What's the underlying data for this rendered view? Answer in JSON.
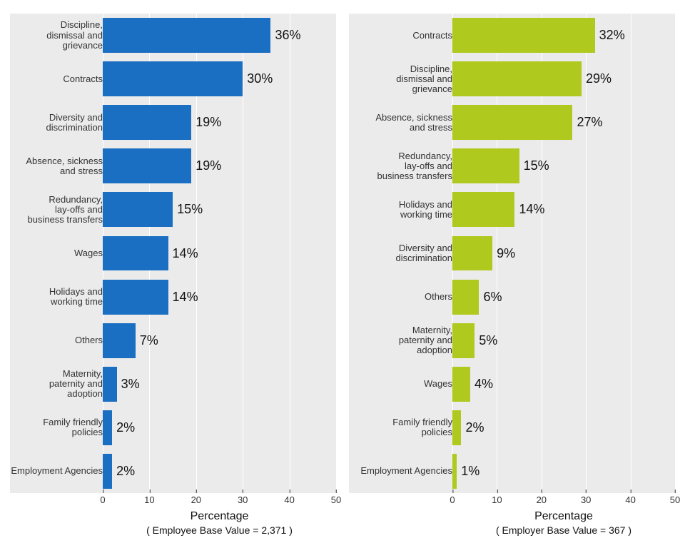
{
  "chart_data": [
    {
      "type": "bar",
      "orientation": "horizontal",
      "color": "#1B6FC2",
      "xlabel": "Percentage",
      "base_label": "( Employee Base Value =  2,371 )",
      "xlim": [
        0,
        50
      ],
      "xticks": [
        0,
        10,
        20,
        30,
        40,
        50
      ],
      "categories": [
        "Discipline,\ndismissal and\ngrievance",
        "Contracts",
        "Diversity and\ndiscrimination",
        "Absence, sickness\nand stress",
        "Redundancy,\nlay-offs and\nbusiness transfers",
        "Wages",
        "Holidays and\nworking time",
        "Others",
        "Maternity,\npaternity and\nadoption",
        "Family friendly\npolicies",
        "Employment Agencies"
      ],
      "values": [
        36,
        30,
        19,
        19,
        15,
        14,
        14,
        7,
        3,
        2,
        2
      ],
      "value_labels": [
        "36%",
        "30%",
        "19%",
        "19%",
        "15%",
        "14%",
        "14%",
        "7%",
        "3%",
        "2%",
        "2%"
      ]
    },
    {
      "type": "bar",
      "orientation": "horizontal",
      "color": "#B0C91E",
      "xlabel": "Percentage",
      "base_label": "( Employer Base Value =  367 )",
      "xlim": [
        0,
        50
      ],
      "xticks": [
        0,
        10,
        20,
        30,
        40,
        50
      ],
      "categories": [
        "Contracts",
        "Discipline,\ndismissal and\ngrievance",
        "Absence, sickness\nand stress",
        "Redundancy,\nlay-offs and\nbusiness transfers",
        "Holidays and\nworking time",
        "Diversity and\ndiscrimination",
        "Others",
        "Maternity,\npaternity and\nadoption",
        "Wages",
        "Family friendly\npolicies",
        "Employment Agencies"
      ],
      "values": [
        32,
        29,
        27,
        15,
        14,
        9,
        6,
        5,
        4,
        2,
        1
      ],
      "value_labels": [
        "32%",
        "29%",
        "27%",
        "15%",
        "14%",
        "9%",
        "6%",
        "5%",
        "4%",
        "2%",
        "1%"
      ]
    }
  ]
}
